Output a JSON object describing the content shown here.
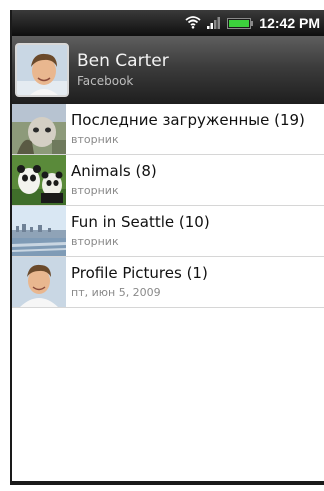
{
  "status_bar": {
    "time": "12:42 PM",
    "icons": [
      "wifi-icon",
      "signal-icon",
      "battery-icon"
    ],
    "battery_color": "#3cd13c"
  },
  "header": {
    "name": "Ben Carter",
    "source": "Facebook"
  },
  "albums": [
    {
      "title": "Последние загруженные (19)",
      "date": "вторник",
      "thumb": "latest-uploads-thumbnail"
    },
    {
      "title": "Animals (8)",
      "date": "вторник",
      "thumb": "panda-thumbnail"
    },
    {
      "title": "Fun in Seattle (10)",
      "date": "вторник",
      "thumb": "seattle-thumbnail"
    },
    {
      "title": "Profile Pictures (1)",
      "date": "пт, июн 5, 2009",
      "thumb": "profile-thumbnail"
    }
  ]
}
